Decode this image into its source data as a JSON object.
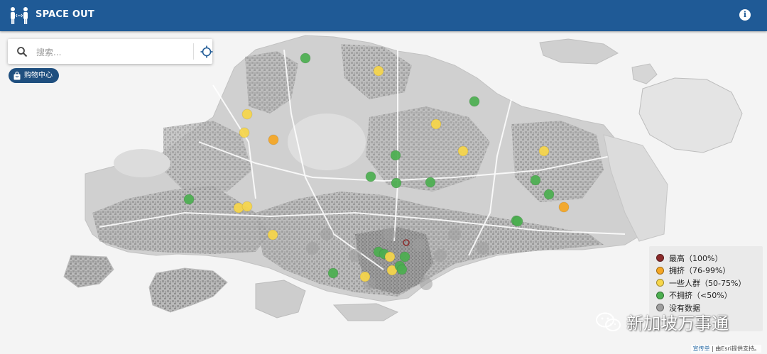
{
  "header": {
    "app_title": "SPACE OUT",
    "logo_icon": "people-icon",
    "info_icon": "info-icon",
    "bar_color": "#1f5a96"
  },
  "search": {
    "placeholder": "搜索...",
    "value": "",
    "search_icon": "search-icon",
    "locate_icon": "crosshair-icon"
  },
  "category_chip": {
    "label": "购物中心",
    "icon": "shopping-bag-icon"
  },
  "legend": {
    "items": [
      {
        "key": "highest",
        "label": "最高（100%）",
        "color": "#8b2a2a"
      },
      {
        "key": "crowded",
        "label": "拥挤（76-99%）",
        "color": "#f5a623"
      },
      {
        "key": "some",
        "label": "一些人群（50-75%）",
        "color": "#f7d64a"
      },
      {
        "key": "not_crowded",
        "label": "不拥挤（<50%）",
        "color": "#4caf50"
      },
      {
        "key": "no_data",
        "label": "没有数据",
        "color": "#9e9e9e"
      }
    ]
  },
  "markers": [
    {
      "status": "not_crowded"
    },
    {
      "status": "some"
    },
    {
      "status": "not_crowded"
    },
    {
      "status": "some"
    },
    {
      "status": "some"
    },
    {
      "status": "crowded"
    },
    {
      "status": "some"
    },
    {
      "status": "some"
    },
    {
      "status": "some"
    },
    {
      "status": "not_crowded"
    },
    {
      "status": "not_crowded"
    },
    {
      "status": "not_crowded"
    },
    {
      "status": "not_crowded"
    },
    {
      "status": "not_crowded"
    },
    {
      "status": "not_crowded"
    },
    {
      "status": "some"
    },
    {
      "status": "not_crowded"
    },
    {
      "status": "crowded"
    },
    {
      "status": "not_crowded"
    },
    {
      "status": "some"
    },
    {
      "status": "some"
    },
    {
      "status": "not_crowded"
    },
    {
      "status": "not_crowded"
    },
    {
      "status": "not_crowded"
    },
    {
      "status": "some"
    },
    {
      "status": "some"
    },
    {
      "status": "not_crowded"
    },
    {
      "status": "not_crowded"
    },
    {
      "status": "not_crowded"
    },
    {
      "status": "some"
    },
    {
      "status": "not_crowded"
    },
    {
      "status": "highest"
    }
  ],
  "watermark": {
    "text": "新加坡万事通",
    "icon": "wechat-icon"
  },
  "attribution": {
    "link_text": "宣传单",
    "text": " | 由Esri提供支持。"
  }
}
